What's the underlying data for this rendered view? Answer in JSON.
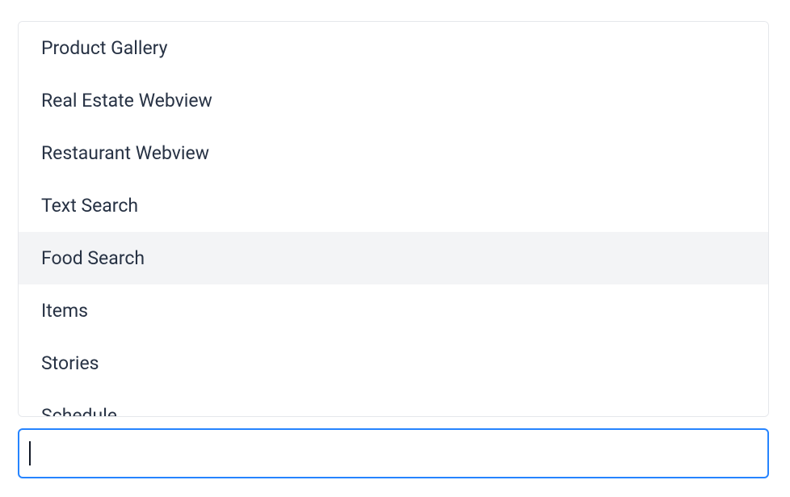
{
  "dropdown": {
    "items": [
      {
        "label": "Product Gallery",
        "highlighted": false
      },
      {
        "label": "Real Estate Webview",
        "highlighted": false
      },
      {
        "label": "Restaurant Webview",
        "highlighted": false
      },
      {
        "label": "Text Search",
        "highlighted": false
      },
      {
        "label": "Food Search",
        "highlighted": true
      },
      {
        "label": "Items",
        "highlighted": false
      },
      {
        "label": "Stories",
        "highlighted": false
      },
      {
        "label": "Schedule",
        "highlighted": false
      }
    ]
  },
  "search": {
    "value": "",
    "placeholder": ""
  }
}
